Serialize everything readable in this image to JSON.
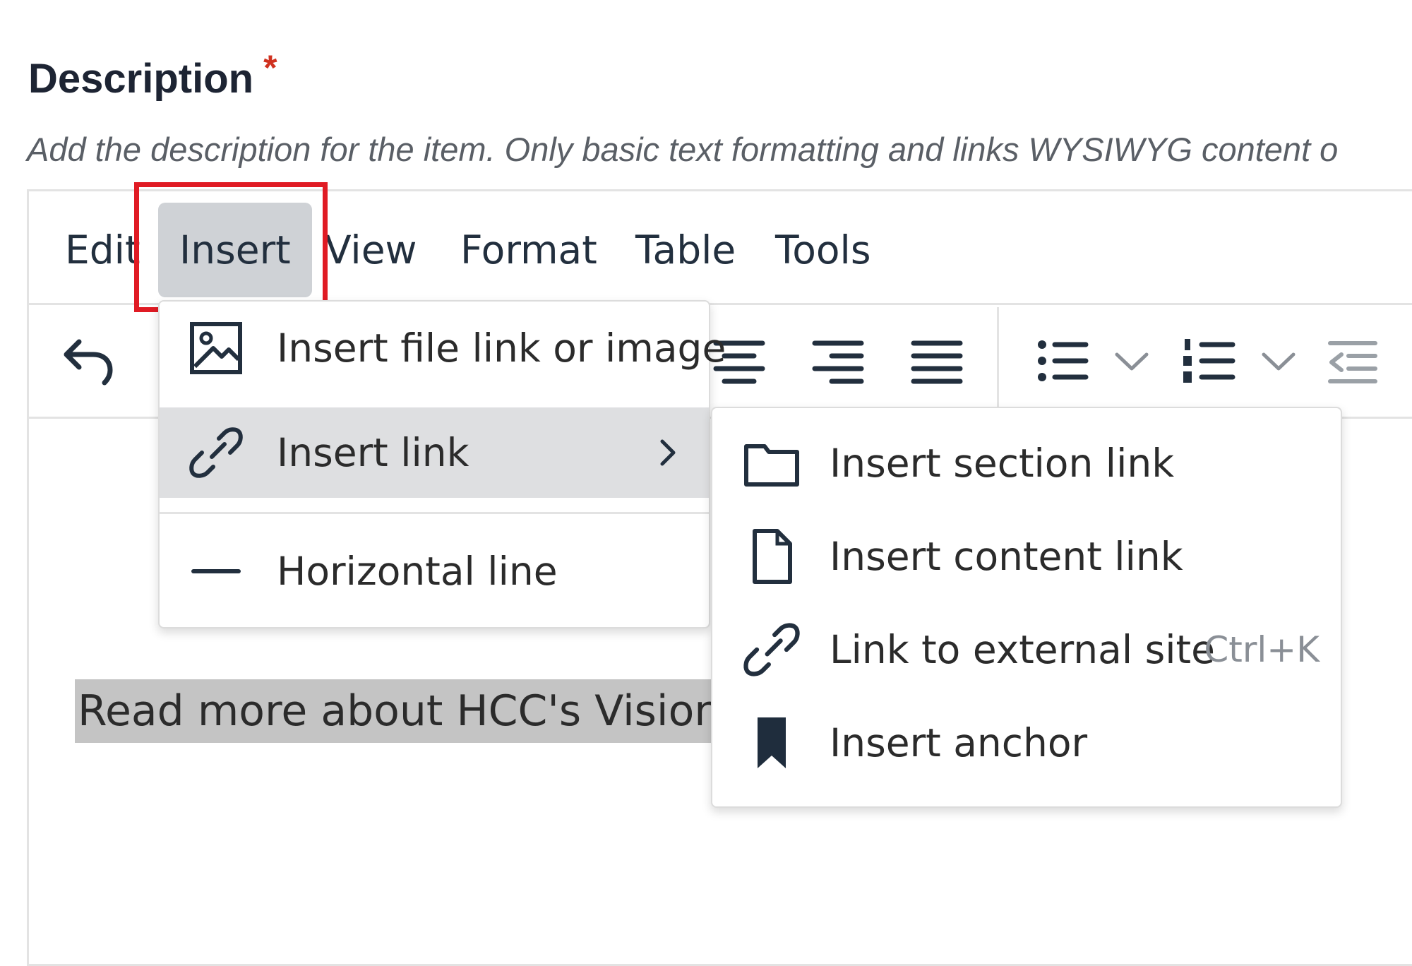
{
  "field": {
    "label": "Description",
    "required_marker": "*",
    "help_text": "Add the description for the item. Only basic text formatting and links WYSIWYG content o"
  },
  "menubar": {
    "items": [
      {
        "label": "Edit"
      },
      {
        "label": "Insert"
      },
      {
        "label": "View"
      },
      {
        "label": "Format"
      },
      {
        "label": "Table"
      },
      {
        "label": "Tools"
      }
    ],
    "active": "Insert"
  },
  "toolbar": {
    "icons": [
      "undo-icon",
      "align-center-icon",
      "align-right-icon",
      "align-justify-icon",
      "bullet-list-icon",
      "chevron-down-icon",
      "numbered-list-icon",
      "chevron-down-icon",
      "outdent-icon"
    ]
  },
  "editor": {
    "content_text": "Read more about HCC's Vision"
  },
  "insert_menu": {
    "items": [
      {
        "label": "Insert file link or image",
        "icon": "image-icon"
      },
      {
        "label": "Insert link",
        "icon": "link-icon",
        "has_submenu": true
      },
      {
        "label": "Horizontal line",
        "icon": "horizontal-line-icon"
      }
    ]
  },
  "link_submenu": {
    "items": [
      {
        "label": "Insert section link",
        "icon": "folder-icon"
      },
      {
        "label": "Insert content link",
        "icon": "document-icon"
      },
      {
        "label": "Link to external site",
        "icon": "link-icon",
        "shortcut": "Ctrl+K"
      },
      {
        "label": "Insert anchor",
        "icon": "bookmark-icon"
      }
    ]
  },
  "colors": {
    "highlight_border": "#e01b24",
    "active_menu_bg": "#cfd2d6",
    "hover_item_bg": "#dedfe1",
    "selected_text_bg": "#c4c4c4",
    "required_marker": "#d0311f"
  }
}
